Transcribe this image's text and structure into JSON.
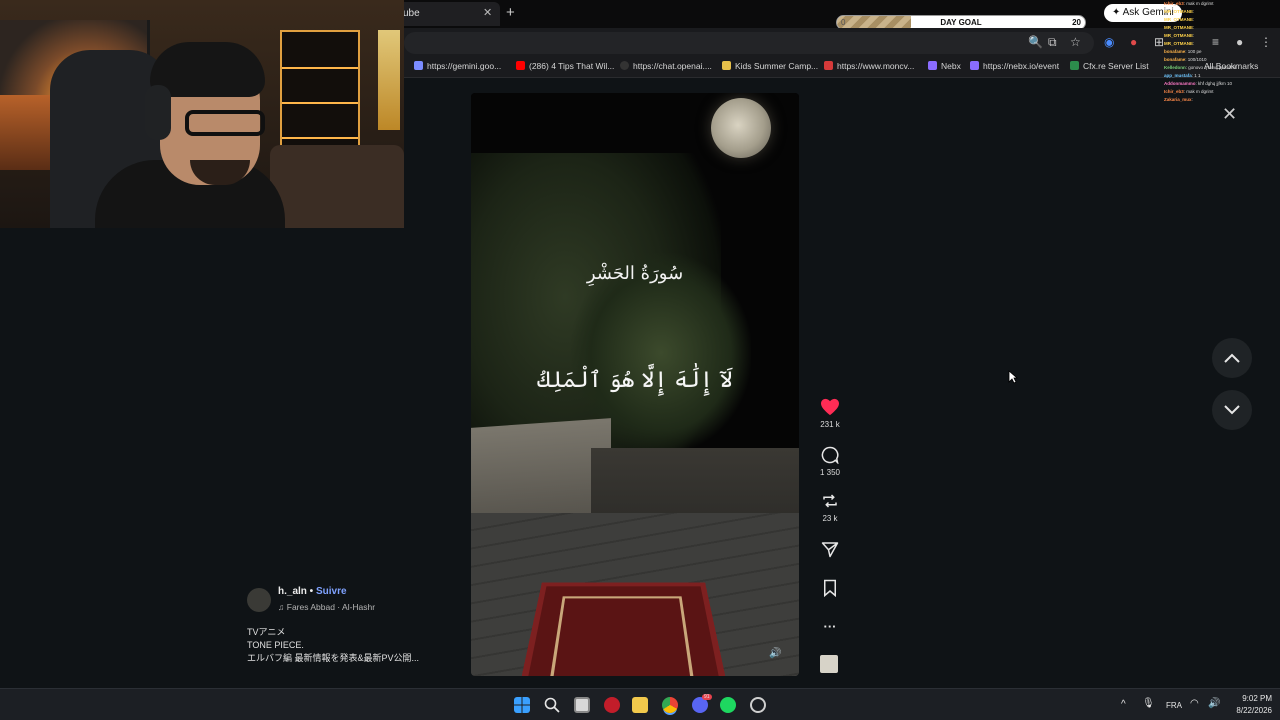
{
  "browser": {
    "tab_title": "ube",
    "tab_close": "✕",
    "new_tab": "+",
    "day_goal": {
      "label": "DAY GOAL",
      "current": "0",
      "target": "20",
      "progress": 0.3
    },
    "ask_gemini": "Ask Gemini",
    "bookmarks": [
      {
        "label": "https://gemini.goo...",
        "color": "#7b8cff"
      },
      {
        "label": "(286) 4 Tips That Wil...",
        "color": "#ff0000"
      },
      {
        "label": "https://chat.openai....",
        "color": "#222222"
      },
      {
        "label": "Kids Summer Camp...",
        "color": "#e7c04a"
      },
      {
        "label": "https://www.moncv...",
        "color": "#d63a3a"
      },
      {
        "label": "Nebx",
        "color": "#8a6cff"
      },
      {
        "label": "https://nebx.io/event",
        "color": "#8a6cff"
      },
      {
        "label": "Cfx.re Server List",
        "color": "#2c8c4c"
      }
    ],
    "all_bookmarks": "All Bookmarks"
  },
  "chat_overlay": {
    "lines": [
      {
        "user": "Ichir_eb3",
        "text": ": mak m dgrimt",
        "color": "#ff8a4a"
      },
      {
        "user": "MR_OTMANE",
        "text": ": ",
        "color": "#ffd34a"
      },
      {
        "user": "MR_OTMANE",
        "text": ": ",
        "color": "#ffd34a"
      },
      {
        "user": "MR_OTMANE",
        "text": ": ",
        "color": "#ffd34a"
      },
      {
        "user": "MR_OTMANE",
        "text": ": ",
        "color": "#ffd34a"
      },
      {
        "user": "MR_OTMANE",
        "text": ": ",
        "color": "#ffd34a"
      },
      {
        "user": "bonafame",
        "text": ": 100 pe",
        "color": "#ffb44a"
      },
      {
        "user": "bonafame",
        "text": ": 100/1010",
        "color": "#ffb44a"
      },
      {
        "user": "Kelledonn",
        "text": ": gonovo q klmq pproof lil",
        "color": "#7ad37a"
      },
      {
        "user": "app_mustafa",
        "text": ": 1 1",
        "color": "#6fc7ff"
      },
      {
        "user": "Addonmammo",
        "text": ": khf dghq jjfkm 10",
        "color": "#ff7ac7"
      },
      {
        "user": "Ichir_eb3",
        "text": ": mak m dgrimt",
        "color": "#ff8a4a"
      },
      {
        "user": "Zakaria_mux",
        "text": ": ",
        "color": "#ff8a4a"
      }
    ],
    "close": "✕"
  },
  "video": {
    "surah_title": "سُورَةُ الحَشْرِ",
    "verse_line": "لَآ إِلَٰهَ إِلَّا هُوَ ٱلْمَلِكُ",
    "sound_icon": "speaker-icon"
  },
  "actions": {
    "likes": "231 k",
    "comments": "1 350",
    "reposts": "23 k",
    "like_color": "#fe2c55"
  },
  "post": {
    "author": "h._aln",
    "separator": " • ",
    "follow": "Suivre",
    "audio": "Fares Abbad · Al-Hashr",
    "caption_lines": [
      "TVアニメ",
      "TONE PIECE.",
      "エルバフ編 最新情報を発表&最新PV公開..."
    ]
  },
  "taskbar": {
    "language": "FRA",
    "time": "9:02 PM",
    "date": "8/22/2026",
    "discord_badge": "91"
  }
}
